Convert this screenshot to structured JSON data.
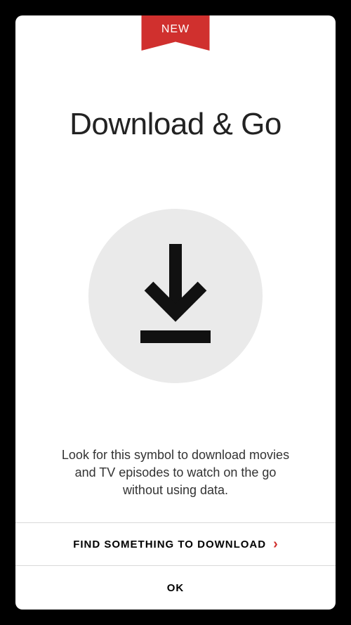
{
  "ribbon": {
    "label": "NEW"
  },
  "title": "Download & Go",
  "description": "Look for this symbol to download movies and TV episodes to watch on the go without using data.",
  "actions": {
    "find": {
      "label": "FIND SOMETHING TO DOWNLOAD"
    },
    "ok": {
      "label": "OK"
    }
  },
  "icons": {
    "download": "download-icon",
    "chevron": "chevron-right-icon"
  },
  "colors": {
    "accent": "#d0302e",
    "background": "#000000",
    "card": "#ffffff",
    "circle": "#eaeaea"
  }
}
